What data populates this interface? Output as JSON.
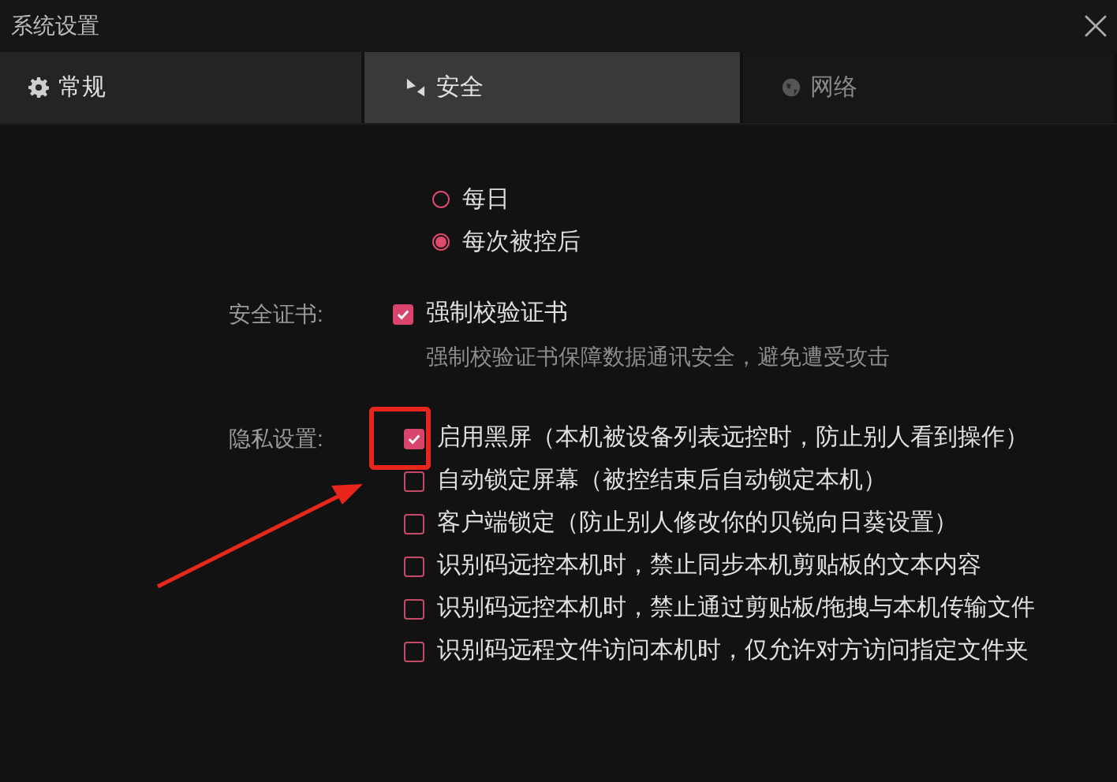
{
  "window": {
    "title": "系统设置"
  },
  "tabs": [
    {
      "label": "常规",
      "selected": false
    },
    {
      "label": "安全",
      "selected": true
    },
    {
      "label": "网络",
      "selected": false
    }
  ],
  "frequency": {
    "options": [
      {
        "label": "每日",
        "selected": false
      },
      {
        "label": "每次被控后",
        "selected": true
      }
    ]
  },
  "certificate": {
    "label": "安全证书:",
    "option": {
      "label": "强制校验证书",
      "checked": true
    },
    "description": "强制校验证书保障数据通讯安全，避免遭受攻击"
  },
  "privacy": {
    "label": "隐私设置:",
    "options": [
      {
        "label": "启用黑屏（本机被设备列表远控时，防止别人看到操作）",
        "checked": true
      },
      {
        "label": "自动锁定屏幕（被控结束后自动锁定本机）",
        "checked": false
      },
      {
        "label": "客户端锁定（防止别人修改你的贝锐向日葵设置）",
        "checked": false
      },
      {
        "label": "识别码远控本机时，禁止同步本机剪贴板的文本内容",
        "checked": false
      },
      {
        "label": "识别码远控本机时，禁止通过剪贴板/拖拽与本机传输文件",
        "checked": false
      },
      {
        "label": "识别码远程文件访问本机时，仅允许对方访问指定文件夹",
        "checked": false
      }
    ]
  }
}
